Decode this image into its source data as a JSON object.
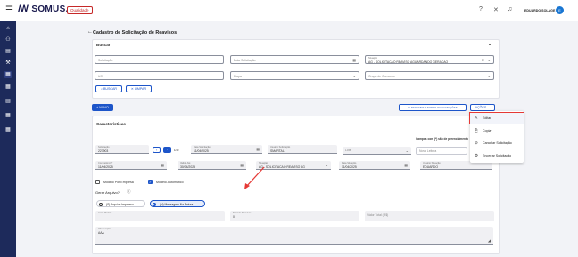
{
  "header": {
    "logo": "ꟿ SOMUS.",
    "env_badge": "Qualidade",
    "username": "EDUARDO SOLAGE",
    "avatar_initial": "E"
  },
  "page": {
    "title": "Cadastro de Solicitação de Reavisos"
  },
  "search": {
    "title": "Buscar",
    "solicitacao_placeholder": "Solicitação",
    "data_solicitacao_placeholder": "Data Solicitação",
    "situacao_label": "Situação",
    "situacao_value": "AG - SOLICITACAO REAVISO AGUARDANDO GERACAO",
    "uc_placeholder": "UC",
    "etapa_placeholder": "Etapa",
    "grupo_consumo_placeholder": "Grupo de Consumo",
    "buscar_label": "BUSCAR",
    "limpar_label": "LIMPAR"
  },
  "toolbar": {
    "novo_label": "+ NOVO",
    "desenhar_label": "DESENHAR TODAS SOLICITAÇÕES",
    "acoes_label": "AÇÕES"
  },
  "characteristics": {
    "title": "Características",
    "required_note": "Campos com (*) são de preenchimento",
    "solicitacao_label": "Solicitação",
    "solicitacao_value": "227903",
    "data_solicitacao_label": "Data Solicitação",
    "data_solicitacao_value": "11/04/2025",
    "usuario_solicitacao_label": "Usuário Solicitação",
    "usuario_solicitacao_value": "SMARTAL",
    "lote_placeholder": "Lote",
    "nova_placeholder": "Nova Leitura",
    "competencia_label": "Competência*",
    "competencia_value": "11/04/2025",
    "valido_ate_label": "Valido Até",
    "valido_ate_value": "30/04/2025",
    "situacao_label": "Situação",
    "situacao_value": "AG - SOLICITACAO REAVISO AG",
    "data_situacao_label": "Data Situação",
    "data_situacao_value": "11/04/2025",
    "usuario_situacao_label": "Usuário Situação",
    "usuario_situacao_value": "EDUARDO",
    "modelo_empresa_label": "Modelo Por Empresa",
    "modelo_automatico_label": "Modelo Automático",
    "gerar_arquivo_label": "Gerar Arquivo?",
    "opcao_arquivo_label": "(S) Arquivo Impresso",
    "opcao_mensagem_label": "(N) Mensagem Na Fatura",
    "auto_modelo_label": "Auto. Modelo",
    "total_reavisos_label": "Total de Reavisos",
    "total_reavisos_value": "0",
    "valor_total_label": "Valor Total (R$)",
    "observacao_label": "Observação",
    "observacao_value": "AAA"
  },
  "actions_menu": {
    "items": [
      {
        "icon": "✎",
        "label": "Editar"
      },
      {
        "icon": "⎘",
        "label": "Copiar"
      },
      {
        "icon": "⊘",
        "label": "Cancelar Solicitação"
      },
      {
        "icon": "⚙",
        "label": "Encerrar Solicitação"
      }
    ]
  },
  "colors": {
    "primary": "#1d55c9",
    "sidebar": "#1d2a5b",
    "highlight": "#e53935"
  }
}
